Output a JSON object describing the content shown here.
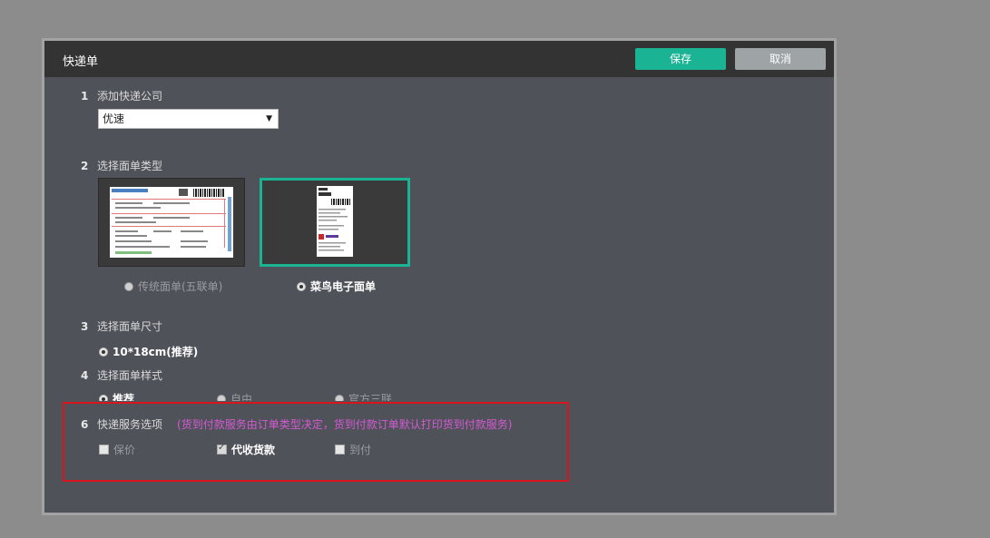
{
  "dialog": {
    "title": "快递单",
    "save_label": "保存",
    "cancel_label": "取消"
  },
  "section1": {
    "number": "1",
    "label": "添加快递公司",
    "select_value": "优速"
  },
  "section2": {
    "number": "2",
    "label": "选择面单类型",
    "options": [
      {
        "label": "传统面单(五联单)",
        "selected": false
      },
      {
        "label": "菜鸟电子面单",
        "selected": true
      }
    ]
  },
  "section3": {
    "number": "3",
    "label": "选择面单尺寸",
    "option": "10*18cm(推荐)"
  },
  "section4": {
    "number": "4",
    "label": "选择面单样式",
    "options": [
      {
        "label": "推荐",
        "selected": true
      },
      {
        "label": "自由",
        "selected": false
      },
      {
        "label": "官方三联",
        "selected": false
      }
    ]
  },
  "section6": {
    "number": "6",
    "label": "快递服务选项",
    "hint": "(货到付款服务由订单类型决定，货到付款订单默认打印货到付款服务)",
    "options": [
      {
        "label": "保价",
        "checked": false
      },
      {
        "label": "代收货款",
        "checked": true
      },
      {
        "label": "到付",
        "checked": false
      }
    ]
  },
  "colors": {
    "accent": "#1ab394",
    "header": "#333333",
    "panel": "#4f5259",
    "highlight_box": "#d9141c",
    "hint_text": "#d45ad4"
  }
}
